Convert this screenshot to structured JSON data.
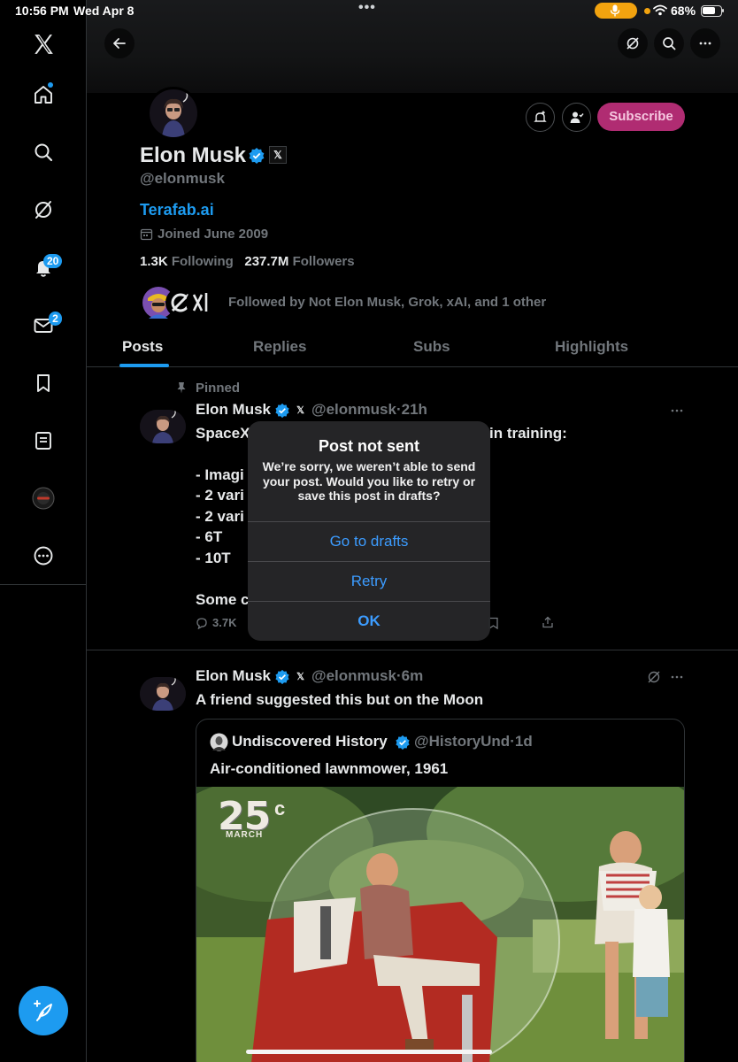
{
  "status_bar": {
    "time": "10:56 PM",
    "date": "Wed Apr 8",
    "dots": "•••",
    "battery": "68%"
  },
  "sidebar": {
    "notifications_badge": "20",
    "messages_badge": "2",
    "icons": [
      "x-logo-icon",
      "home-icon",
      "search-icon",
      "grok-icon",
      "bell-icon",
      "mail-icon",
      "bookmark-icon",
      "lists-icon",
      "spaces-icon",
      "more-icon"
    ]
  },
  "profile": {
    "name": "Elon Musk",
    "handle": "@elonmusk",
    "link": "Terafab.ai",
    "joined": "Joined June 2009",
    "following_count": "1.3K",
    "following_label": "Following",
    "followers_count": "237.7M",
    "followers_label": "Followers",
    "followed_by": "Followed by Not Elon Musk, Grok, xAI, and 1 other",
    "subscribe_label": "Subscribe"
  },
  "tabs": [
    "Posts",
    "Replies",
    "Subs",
    "Highlights"
  ],
  "post1": {
    "pinned": "Pinned",
    "name": "Elon Musk",
    "handle": "@elonmusk",
    "sep": "·",
    "time": "21h",
    "line1_left": "SpaceX",
    "line1_right": "in training:",
    "line2": "- Imagi",
    "line3": "- 2 vari",
    "line4": "- 2 vari",
    "line5": "- 6T",
    "line6": "- 10T",
    "line7": "Some c",
    "replies": "3.7K"
  },
  "post2": {
    "name": "Elon Musk",
    "handle": "@elonmusk",
    "sep": "·",
    "time": "6m",
    "text": "A friend suggested this but on the Moon",
    "quote_name": "Undiscovered History",
    "quote_handle": "@HistoryUnd",
    "quote_time": "1d",
    "quote_text": "Air-conditioned lawnmower, 1961",
    "magazine_number": "25",
    "magazine_cents": "c",
    "magazine_month": "MARCH"
  },
  "dialog": {
    "title": "Post not sent",
    "message": "We’re sorry, we weren’t able to send your post. Would you like to retry or save this post in drafts?",
    "btn_drafts": "Go to drafts",
    "btn_retry": "Retry",
    "btn_ok": "OK"
  },
  "colors": {
    "accent": "#1d9bf0",
    "subscribe": "#b02c72",
    "dialog_button": "#3c9cff"
  }
}
